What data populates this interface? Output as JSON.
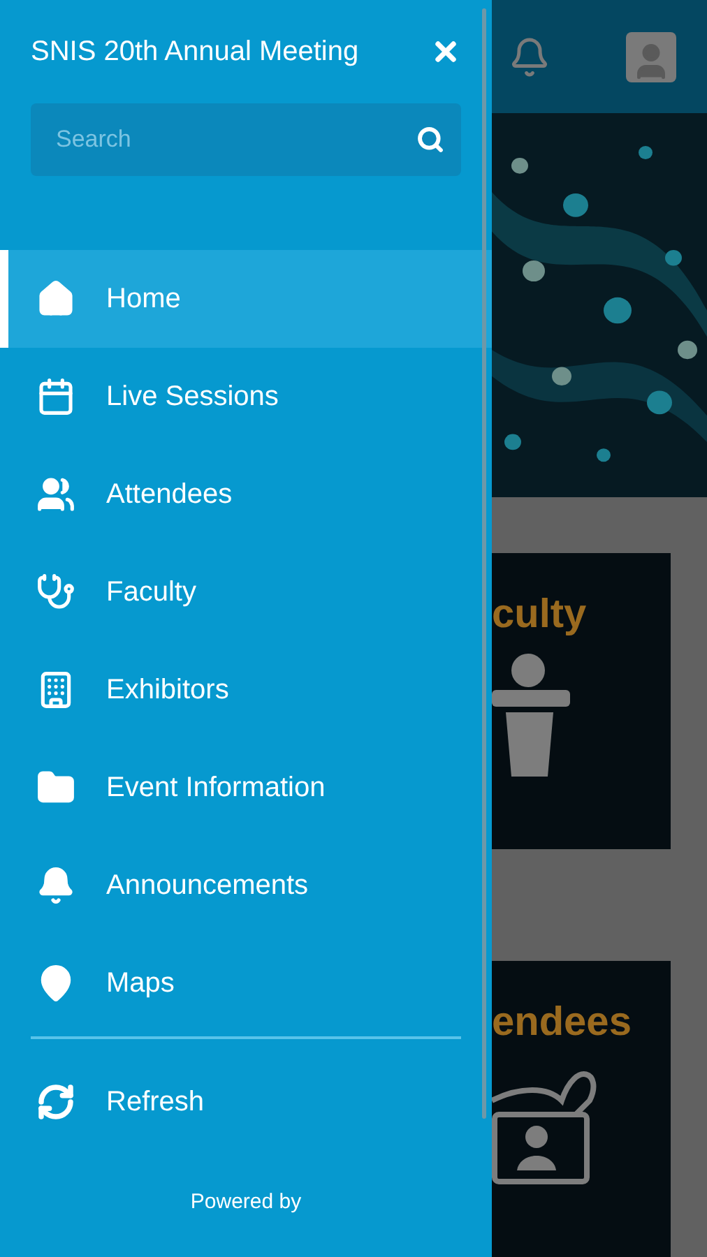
{
  "drawer": {
    "title": "SNIS 20th Annual Meeting",
    "search": {
      "placeholder": "Search"
    },
    "menu": [
      {
        "label": "Home",
        "selected": true
      },
      {
        "label": "Live Sessions",
        "selected": false
      },
      {
        "label": "Attendees",
        "selected": false
      },
      {
        "label": "Faculty",
        "selected": false
      },
      {
        "label": "Exhibitors",
        "selected": false
      },
      {
        "label": "Event Information",
        "selected": false
      },
      {
        "label": "Announcements",
        "selected": false
      },
      {
        "label": "Maps",
        "selected": false
      }
    ],
    "footer_menu": [
      {
        "label": "Refresh",
        "selected": false
      }
    ],
    "powered_by": "Powered by"
  },
  "background_page": {
    "cards": [
      {
        "title": "culty",
        "kind": "podium"
      },
      {
        "title": "endees",
        "kind": "badge"
      }
    ]
  }
}
